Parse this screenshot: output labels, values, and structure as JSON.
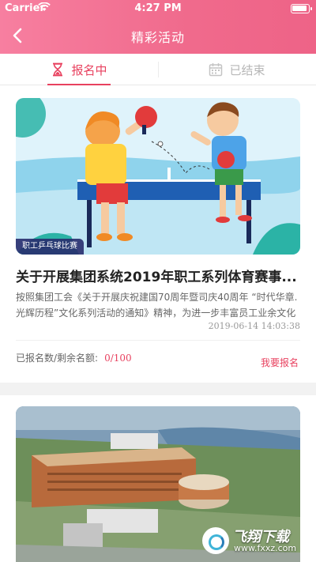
{
  "status_bar": {
    "carrier": "Carrier",
    "time": "4:27 PM"
  },
  "nav": {
    "title": "精彩活动"
  },
  "tabs": [
    {
      "label": "报名中",
      "icon": "hourglass-icon",
      "active": true
    },
    {
      "label": "已结束",
      "icon": "calendar-icon",
      "active": false
    }
  ],
  "activities": [
    {
      "banner_tag": "职工乒乓球比赛",
      "title": "关于开展集团系统2019年职工系列体育赛事...",
      "description": "按照集团工会《关于开展庆祝建国70周年暨司庆40周年 “时代华章.光辉历程”文化系列活动的通知》精神，为进一步丰富员工业余文化生活...",
      "date": "2019-06-14 14:03:38",
      "count_label": "已报名数/剩余名额:",
      "count_value": "0/100",
      "cta": "我要报名"
    }
  ],
  "watermark": {
    "title": "飞翔下载",
    "url": "www.fxxz.com"
  },
  "colors": {
    "accent": "#e8415f",
    "header_start": "#f77fa0",
    "header_end": "#ee6387"
  }
}
